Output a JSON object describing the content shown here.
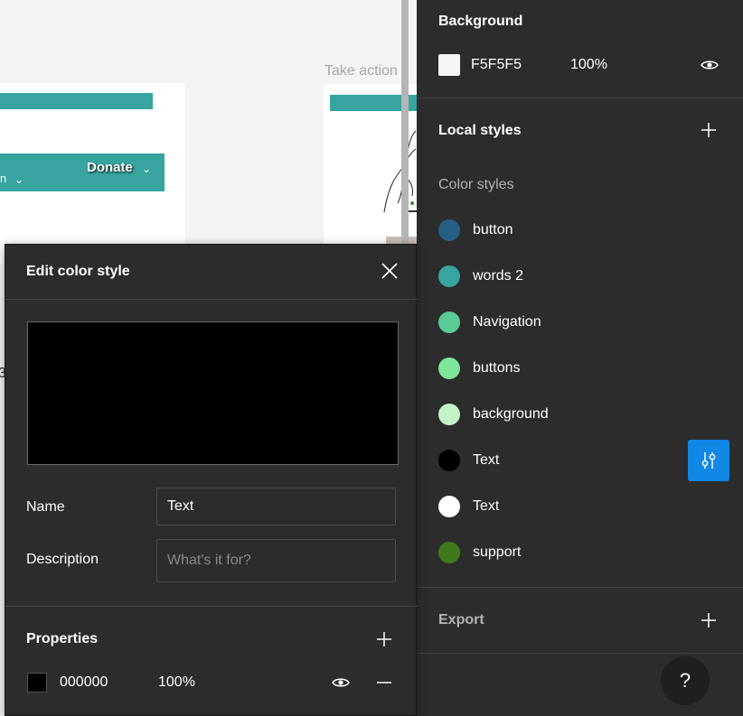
{
  "canvas": {
    "nav_item_left": "n",
    "nav_donate": "Donate",
    "frame_label": "Take action",
    "stray_glyph": "3"
  },
  "background": {
    "title": "Background",
    "hex": "F5F5F5",
    "opacity": "100%",
    "swatch_color": "#f5f5f5"
  },
  "local_styles": {
    "title": "Local styles",
    "subhead": "Color styles",
    "items": [
      {
        "label": "button",
        "color": "#255f85"
      },
      {
        "label": "words 2",
        "color": "#38a4a0"
      },
      {
        "label": "Navigation",
        "color": "#58cb96"
      },
      {
        "label": "buttons",
        "color": "#7ee59b"
      },
      {
        "label": "background",
        "color": "#c3f4c9"
      },
      {
        "label": "Text",
        "color": "#000000"
      },
      {
        "label": "Text",
        "color": "#ffffff"
      },
      {
        "label": "support",
        "color": "#3e7a1b"
      }
    ]
  },
  "export": {
    "title": "Export"
  },
  "help": {
    "label": "?"
  },
  "modal": {
    "title": "Edit color style",
    "preview_color": "#000000",
    "name_label": "Name",
    "name_value": "Text",
    "description_label": "Description",
    "description_placeholder": "What's it for?",
    "properties_title": "Properties",
    "property": {
      "hex": "000000",
      "opacity": "100%",
      "color": "#000000"
    }
  },
  "colors": {
    "panel_bg": "#2c2c2c",
    "accent_blue": "#1187e6",
    "teal": "#38a4a0"
  }
}
